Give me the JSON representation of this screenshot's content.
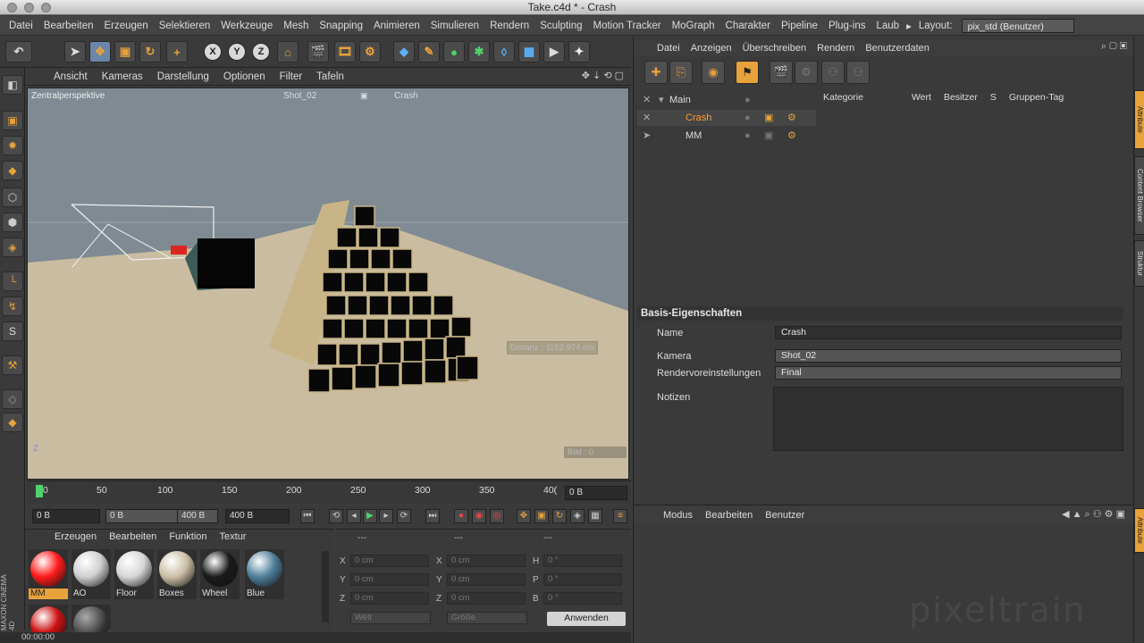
{
  "window": {
    "title": "Take.c4d * - Crash"
  },
  "menubar": {
    "items": [
      "Datei",
      "Bearbeiten",
      "Erzeugen",
      "Selektieren",
      "Werkzeuge",
      "Mesh",
      "Snapping",
      "Animieren",
      "Simulieren",
      "Rendern",
      "Sculpting",
      "Motion Tracker",
      "MoGraph",
      "Charakter",
      "Pipeline",
      "Plug-ins",
      "Laub"
    ],
    "layout_label": "Layout:",
    "layout_value": "pix_std (Benutzer)"
  },
  "toolbar": {
    "x": "X",
    "y": "Y",
    "z": "Z"
  },
  "viewport": {
    "menu": [
      "Ansicht",
      "Kameras",
      "Darstellung",
      "Optionen",
      "Filter",
      "Tafeln"
    ],
    "perspective": "Zentralperspektive",
    "camera": "Shot_02",
    "take": "Crash",
    "distance": "Distanz : 1152.974 cm",
    "frame": "Bild : 0",
    "axis": "Z"
  },
  "timeline": {
    "ticks": [
      "0",
      "50",
      "100",
      "150",
      "200",
      "250",
      "300",
      "350",
      "40("
    ],
    "current": "0 B"
  },
  "transport": {
    "start": "0 B",
    "min": "0 B",
    "max": "400 B",
    "end": "400 B"
  },
  "materials": {
    "menu": [
      "Erzeugen",
      "Bearbeiten",
      "Funktion",
      "Textur"
    ],
    "items": [
      {
        "name": "MM",
        "color": "#ff1a1a"
      },
      {
        "name": "AO",
        "color": "#cfcfcf"
      },
      {
        "name": "Floor",
        "color": "#d6d6d6"
      },
      {
        "name": "Boxes",
        "color": "#cbbfa6"
      },
      {
        "name": "Wheel",
        "color": "#1a1a1a"
      },
      {
        "name": "Blue",
        "color": "#4f7f9b"
      }
    ]
  },
  "coords": {
    "headers": [
      "---",
      "---",
      "---"
    ],
    "rows": [
      {
        "a": "X",
        "av": "0 cm",
        "b": "X",
        "bv": "0 cm",
        "c": "H",
        "cv": "0 °"
      },
      {
        "a": "Y",
        "av": "0 cm",
        "b": "Y",
        "bv": "0 cm",
        "c": "P",
        "cv": "0 °"
      },
      {
        "a": "Z",
        "av": "0 cm",
        "b": "Z",
        "bv": "0 cm",
        "c": "B",
        "cv": "0 °"
      }
    ],
    "mode1": "Welt",
    "mode2": "Größe",
    "apply": "Anwenden"
  },
  "status": {
    "time": "00:00:00"
  },
  "takes": {
    "menu": [
      "Datei",
      "Anzeigen",
      "Überschreiben",
      "Rendern",
      "Benutzerdaten"
    ],
    "tree": [
      {
        "name": "Main",
        "indent": 0
      },
      {
        "name": "Crash",
        "indent": 1,
        "active": true
      },
      {
        "name": "MM",
        "indent": 1
      }
    ],
    "columns": [
      "Kategorie",
      "Wert",
      "Besitzer",
      "S",
      "Gruppen-Tag"
    ]
  },
  "attributes": {
    "title": "Basis-Eigenschaften",
    "name_label": "Name",
    "name_value": "Crash",
    "camera_label": "Kamera",
    "camera_value": "Shot_02",
    "render_label": "Rendervoreinstellungen",
    "render_value": "Final",
    "notes_label": "Notizen"
  },
  "layers": {
    "menu": [
      "Modus",
      "Bearbeiten",
      "Benutzer"
    ]
  },
  "watermark": "pixeltrain",
  "side_tabs": [
    "Attribute",
    "Content Browser",
    "Struktur"
  ],
  "brand": "MAXON CINEMA 4D"
}
